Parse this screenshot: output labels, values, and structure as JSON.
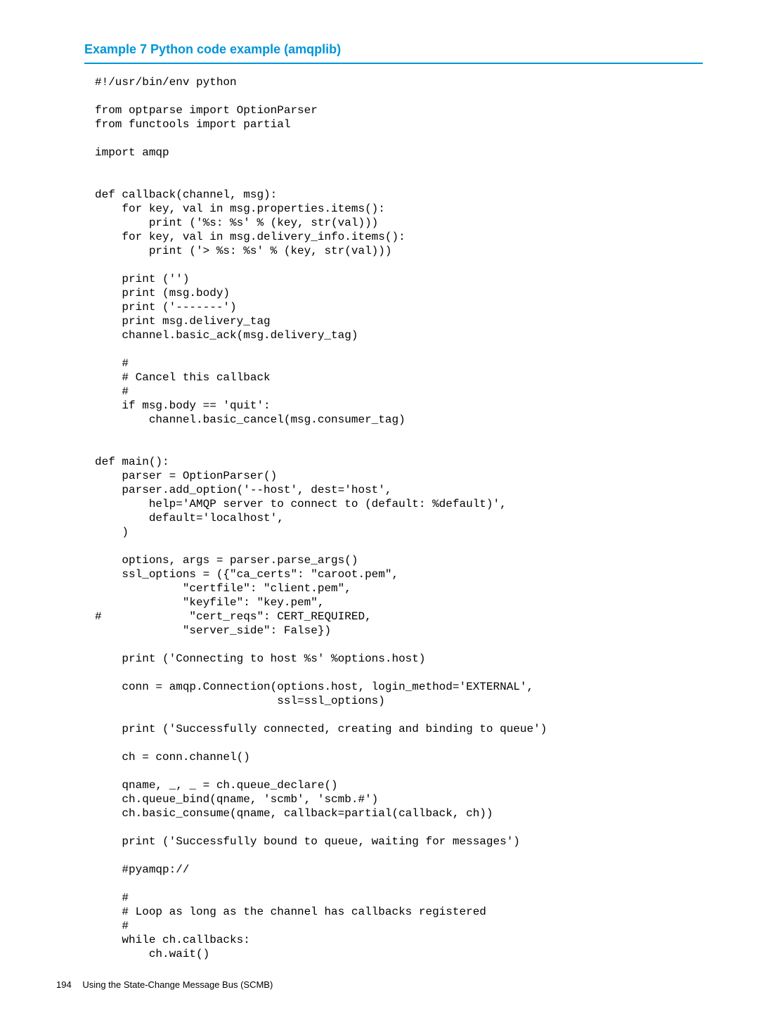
{
  "example": {
    "title": "Example 7 Python code example (amqplib)"
  },
  "code": "#!/usr/bin/env python\n\nfrom optparse import OptionParser\nfrom functools import partial\n\nimport amqp\n\n\ndef callback(channel, msg):\n    for key, val in msg.properties.items():\n        print ('%s: %s' % (key, str(val)))\n    for key, val in msg.delivery_info.items():\n        print ('> %s: %s' % (key, str(val)))\n\n    print ('')\n    print (msg.body)\n    print ('-------')\n    print msg.delivery_tag\n    channel.basic_ack(msg.delivery_tag)\n\n    #\n    # Cancel this callback\n    #\n    if msg.body == 'quit':\n        channel.basic_cancel(msg.consumer_tag)\n\n\ndef main():\n    parser = OptionParser()\n    parser.add_option('--host', dest='host',\n        help='AMQP server to connect to (default: %default)',\n        default='localhost',\n    )\n\n    options, args = parser.parse_args()\n    ssl_options = ({\"ca_certs\": \"caroot.pem\",\n             \"certfile\": \"client.pem\",\n             \"keyfile\": \"key.pem\",\n#             \"cert_reqs\": CERT_REQUIRED,\n             \"server_side\": False})\n\n    print ('Connecting to host %s' %options.host)\n\n    conn = amqp.Connection(options.host, login_method='EXTERNAL',\n                           ssl=ssl_options)\n\n    print ('Successfully connected, creating and binding to queue')\n\n    ch = conn.channel()\n\n    qname, _, _ = ch.queue_declare()\n    ch.queue_bind(qname, 'scmb', 'scmb.#')\n    ch.basic_consume(qname, callback=partial(callback, ch))\n\n    print ('Successfully bound to queue, waiting for messages')\n\n    #pyamqp://\n\n    #\n    # Loop as long as the channel has callbacks registered\n    #\n    while ch.callbacks:\n        ch.wait()",
  "footer": {
    "page_number": "194",
    "section_title": "Using the State-Change Message Bus (SCMB)"
  }
}
